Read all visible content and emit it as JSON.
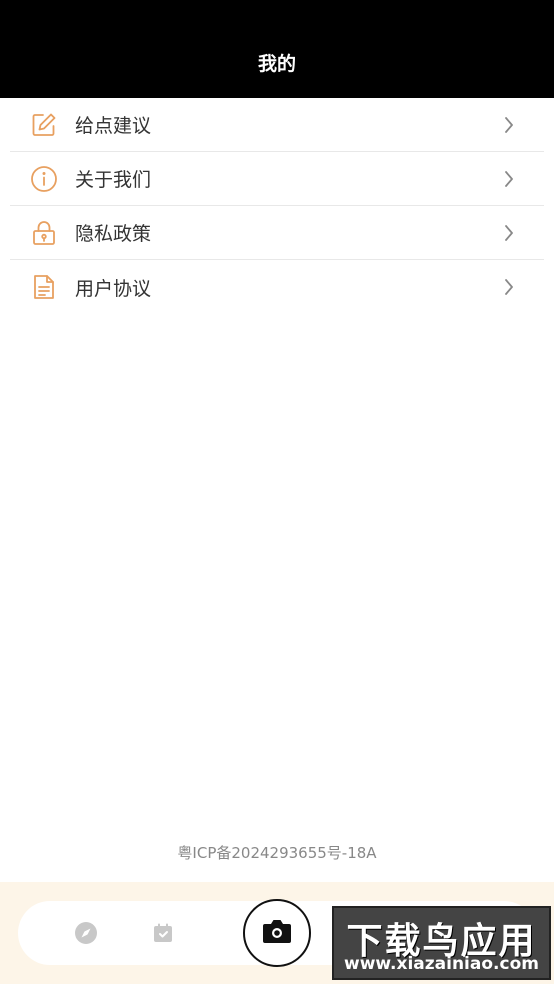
{
  "header": {
    "title": "我的"
  },
  "menu": {
    "items": [
      {
        "label": "给点建议",
        "icon": "edit-icon"
      },
      {
        "label": "关于我们",
        "icon": "info-icon"
      },
      {
        "label": "隐私政策",
        "icon": "lock-icon"
      },
      {
        "label": "用户协议",
        "icon": "document-icon"
      }
    ]
  },
  "footer": {
    "icp": "粤ICP备2024293655号-18A"
  },
  "tabbar": {
    "icons": [
      "compass-icon",
      "calendar-icon",
      "camera-icon"
    ]
  },
  "watermark": {
    "title": "下载鸟应用",
    "url": "www.xiazainiao.com"
  },
  "colors": {
    "header_bg": "#000000",
    "accent": "#e8a060",
    "tabbar_area_bg": "#fdf5e8"
  }
}
